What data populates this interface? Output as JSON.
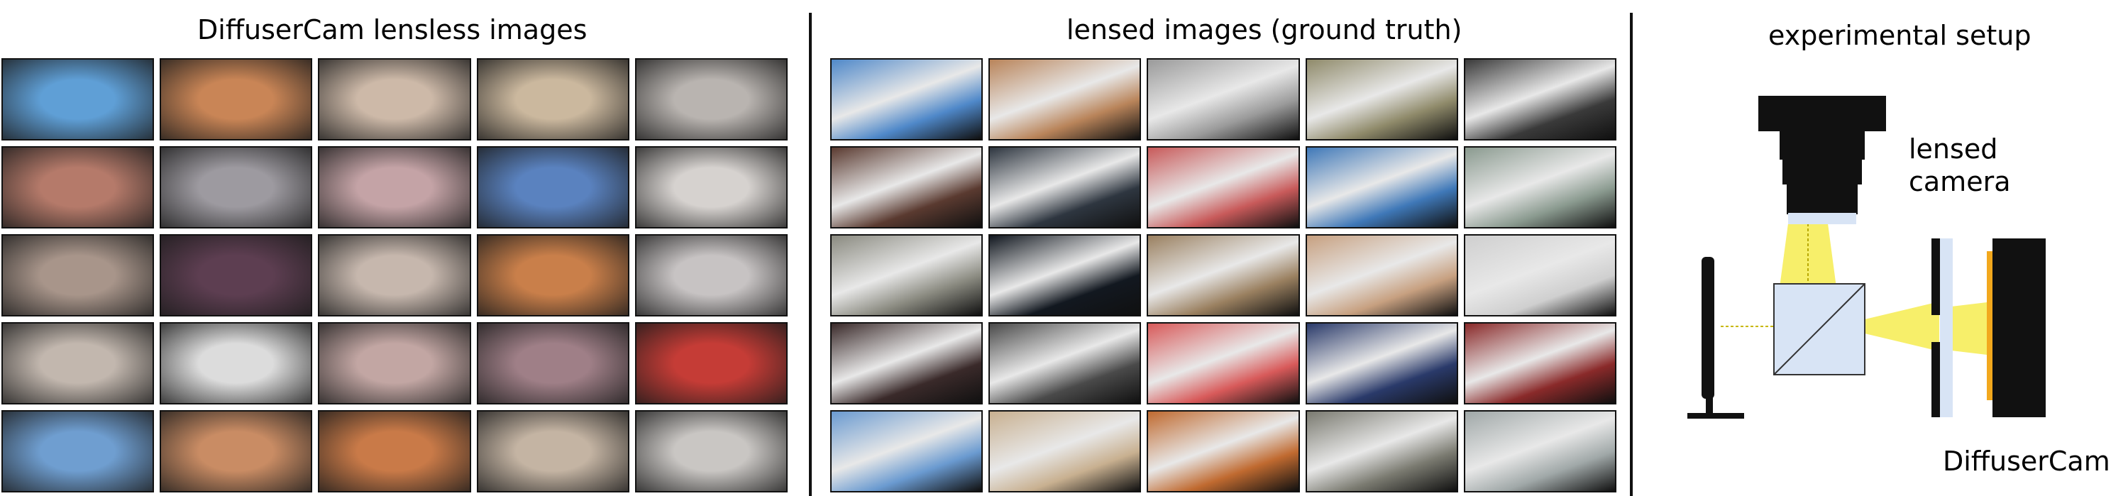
{
  "panels": {
    "lensless_title": "DiffuserCam lensless images",
    "lensed_title": "lensed images (ground truth)",
    "setup_title": "experimental setup"
  },
  "setup": {
    "lensed_camera_line1": "lensed",
    "lensed_camera_line2": "camera",
    "diffusercam_label": "DiffuserCam"
  },
  "colors": {
    "beam": "#f7ef6a",
    "sensor": "#f2a81d",
    "optics": "#d8e4f5"
  },
  "lensless_images": [
    [
      "#5f9fd6",
      "#c98556",
      "#cdb9a8",
      "#cbb89e",
      "#b9b4b0"
    ],
    [
      "#b57a6a",
      "#9d9aa0",
      "#c4a3a6",
      "#5a82bf",
      "#d6d2cf"
    ],
    [
      "#a8958a",
      "#5d3e51",
      "#c6b7ad",
      "#c97f4a",
      "#c7c3c3"
    ],
    [
      "#c2b7ae",
      "#dcdcdc",
      "#c2a6a3",
      "#9f7f87",
      "#c53c36"
    ],
    [
      "#6f9ed0",
      "#c98c64",
      "#c97a48",
      "#c4b4a3",
      "#c9c6c3"
    ]
  ],
  "lensed_images": [
    [
      "#4f88c9",
      "#b9845a",
      "#9a9a9a",
      "#8f8a6a",
      "#3a3a3a"
    ],
    [
      "#5a3a30",
      "#2e3640",
      "#c85a5a",
      "#3f78b8",
      "#8a9a8f"
    ],
    [
      "#8a8a80",
      "#121820",
      "#9a8060",
      "#c7a080",
      "#cfcfcf"
    ],
    [
      "#3a2a2a",
      "#4a4a4a",
      "#d85a5a",
      "#2a3a6a",
      "#8a2a2a"
    ],
    [
      "#6a9ad0",
      "#c8b090",
      "#c06a30",
      "#7a7a70",
      "#a0a8a8"
    ]
  ]
}
